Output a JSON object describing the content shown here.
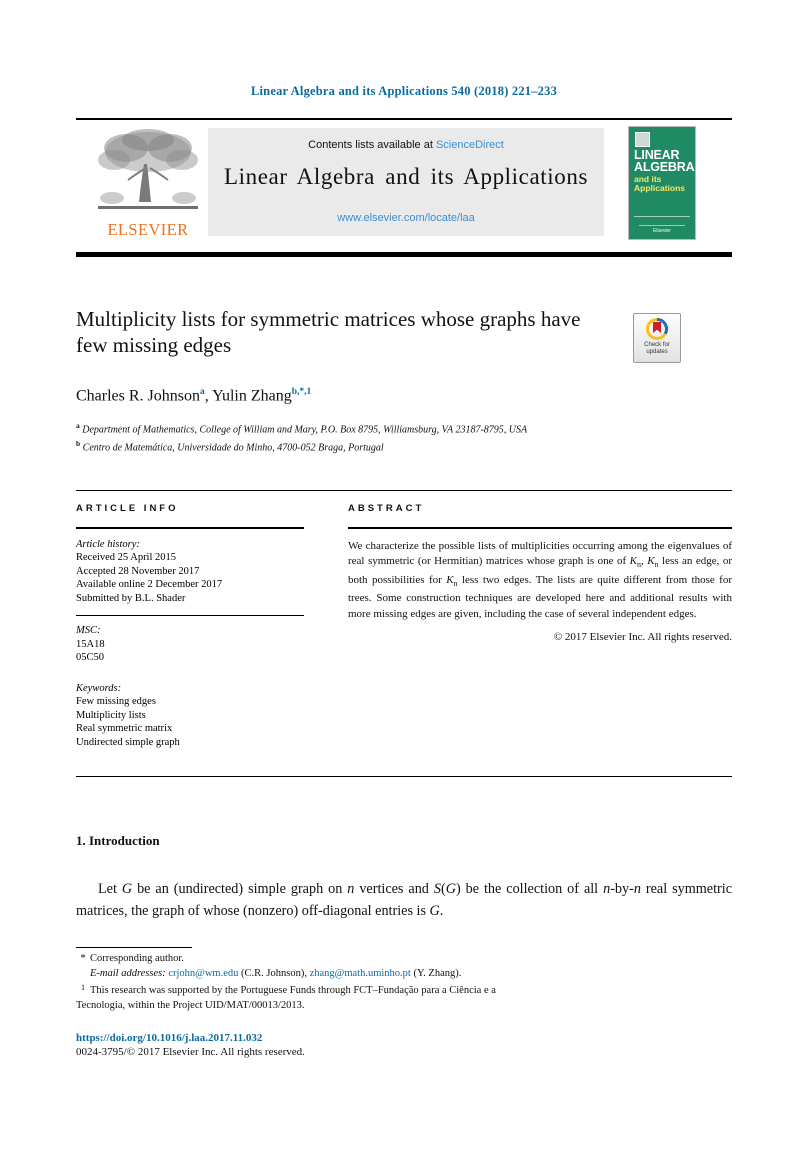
{
  "running_head": "Linear Algebra and its Applications 540 (2018) 221–233",
  "masthead": {
    "contents_prefix": "Contents lists available at ",
    "sciencedirect": "ScienceDirect",
    "journal_title": "Linear Algebra and its Applications",
    "journal_url": "www.elsevier.com/locate/laa",
    "publisher_wordmark": "ELSEVIER",
    "cover": {
      "line1": "LINEAR",
      "line2": "ALGEBRA",
      "line3": "and its",
      "line4": "Applications",
      "footer_brand": "Elsevier"
    },
    "colors": {
      "band_bg": "#eaeaea",
      "link": "#3b8fd4",
      "elsevier_orange": "#e87422",
      "cover_green": "#1f8a63",
      "running_head": "#0b6aa2"
    }
  },
  "article": {
    "title": "Multiplicity lists for symmetric matrices whose graphs have few missing edges",
    "authors": [
      {
        "name": "Charles R. Johnson",
        "marks": "a"
      },
      {
        "name": "Yulin Zhang",
        "marks": "b,*,1"
      }
    ],
    "affiliations": [
      {
        "mark": "a",
        "text": "Department of Mathematics, College of William and Mary, P.O. Box 8795, Williamsburg, VA 23187-8795, USA"
      },
      {
        "mark": "b",
        "text": "Centro de Matemática, Universidade do Minho, 4700-052 Braga, Portugal"
      }
    ],
    "crossmark": {
      "line1": "Check for",
      "line2": "updates"
    }
  },
  "article_info": {
    "heading": "ARTICLE INFO",
    "history_label": "Article history:",
    "history": [
      "Received 25 April 2015",
      "Accepted 28 November 2017",
      "Available online 2 December 2017",
      "Submitted by B.L. Shader"
    ],
    "msc_label": "MSC:",
    "msc": [
      "15A18",
      "05C50"
    ],
    "keywords_label": "Keywords:",
    "keywords": [
      "Few missing edges",
      "Multiplicity lists",
      "Real symmetric matrix",
      "Undirected simple graph"
    ]
  },
  "abstract": {
    "heading": "ABSTRACT",
    "part1": "We characterize the possible lists of multiplicities occurring among the eigenvalues of real symmetric (or Hermitian) matrices whose graph is one of ",
    "kn1": "K",
    "kn_sub": "n",
    "part2": ", ",
    "kn2": "K",
    "part3": " less an edge, or both possibilities for ",
    "kn3": "K",
    "part4": " less two edges. The lists are quite different from those for trees. Some construction techniques are developed here and additional results with more missing edges are given, including the case of several independent edges.",
    "copyright": "© 2017 Elsevier Inc. All rights reserved."
  },
  "body": {
    "section_heading": "1. Introduction",
    "paragraph": {
      "t1": "Let ",
      "g1": "G",
      "t2": " be an (undirected) simple graph on ",
      "n1": "n",
      "t3": " vertices and ",
      "s1": "S",
      "t4": "(",
      "g2": "G",
      "t5": ") be the collection of all ",
      "n2": "n",
      "t6": "-by-",
      "n3": "n",
      "t7": " real symmetric matrices, the graph of whose (nonzero) off-diagonal entries is ",
      "g3": "G",
      "t8": "."
    }
  },
  "footnotes": {
    "corresponding": "Corresponding author.",
    "email_label": "E-mail addresses:",
    "email1": "crjohn@wm.edu",
    "email1_owner": "(C.R. Johnson),",
    "email2": "zhang@math.uminho.pt",
    "email2_owner": "(Y. Zhang).",
    "note1_line1": "This research was supported by the Portuguese Funds through FCT–Fundação para a Ciência e a",
    "note1_line2": "Tecnologia, within the Project UID/MAT/00013/2013."
  },
  "footer": {
    "doi": "https://doi.org/10.1016/j.laa.2017.11.032",
    "issn_line": "0024-3795/© 2017 Elsevier Inc. All rights reserved."
  }
}
